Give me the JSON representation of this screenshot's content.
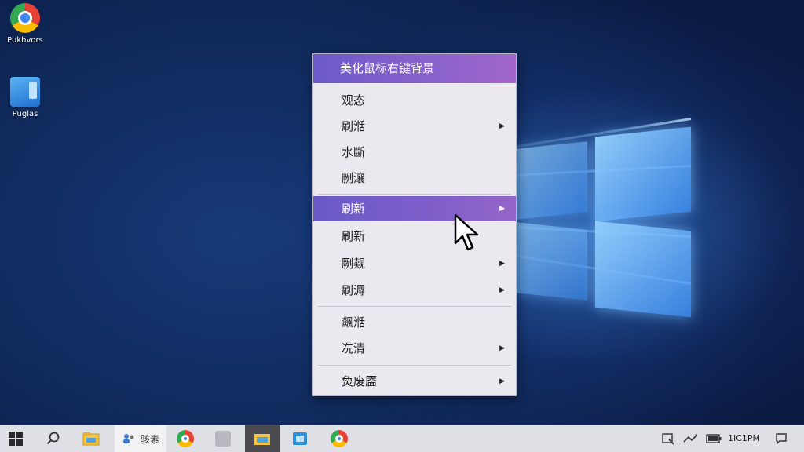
{
  "desktop": {
    "icons": [
      {
        "label": "Pukhvors",
        "icon": "chrome-icon"
      },
      {
        "label": "Puglas",
        "icon": "app-icon"
      }
    ]
  },
  "context_menu": {
    "header": "美化鼠标右键背景",
    "items": [
      {
        "label": "观态",
        "has_submenu": false,
        "highlighted": false
      },
      {
        "label": "刷湉",
        "has_submenu": true,
        "highlighted": false
      },
      {
        "label": "水斷",
        "has_submenu": false,
        "highlighted": false
      },
      {
        "label": "劂瀼",
        "has_submenu": false,
        "highlighted": false
      },
      {
        "label": "刷新",
        "has_submenu": true,
        "highlighted": true
      },
      {
        "label": "刷新",
        "has_submenu": false,
        "highlighted": false
      },
      {
        "label": "劂觌",
        "has_submenu": true,
        "highlighted": false
      },
      {
        "label": "刷溽",
        "has_submenu": true,
        "highlighted": false
      },
      {
        "label": "飆湉",
        "has_submenu": false,
        "highlighted": false
      },
      {
        "label": "冼清",
        "has_submenu": true,
        "highlighted": false
      },
      {
        "label": "烉废靥",
        "has_submenu": true,
        "highlighted": false
      }
    ],
    "submenu_arrow": "▶"
  },
  "taskbar": {
    "search_label": "骇素",
    "apps": [
      "start-icon",
      "search-icon",
      "file-explorer-icon",
      "search-box",
      "chrome-icon",
      "app-icon",
      "explorer-active-icon",
      "store-icon",
      "chrome-icon"
    ],
    "tray": {
      "time": "1IC1PM"
    }
  },
  "colors": {
    "menu_accent": "#7f5fca",
    "menu_background": "#ebe8f0",
    "taskbar_background": "#dfe0e6"
  }
}
